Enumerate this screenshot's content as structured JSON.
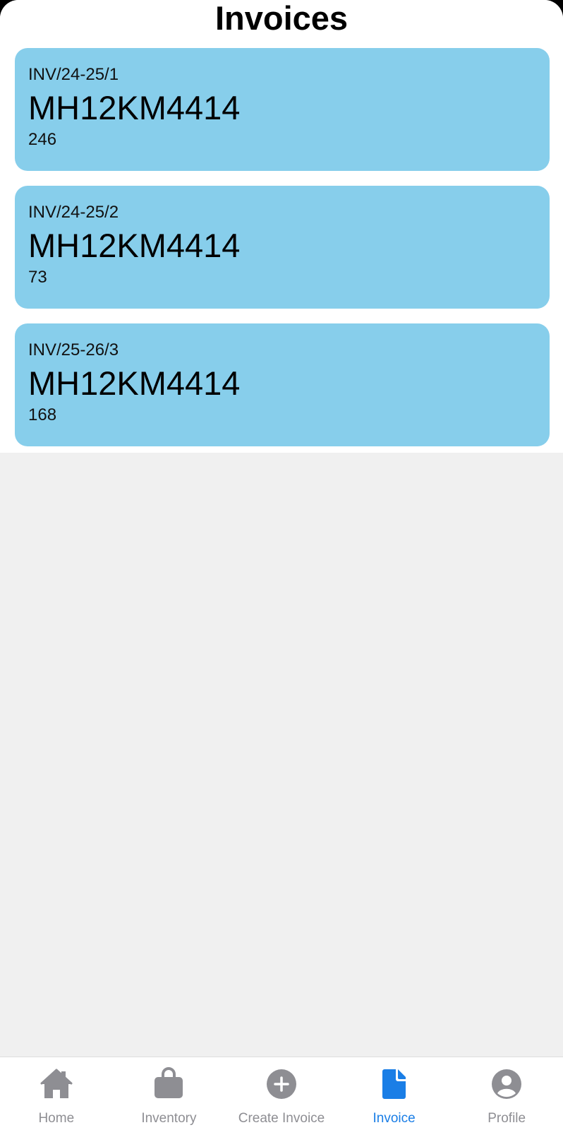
{
  "header": {
    "title": "Invoices"
  },
  "invoices": [
    {
      "number": "INV/24-25/1",
      "vehicle": "MH12KM4414",
      "amount": "246"
    },
    {
      "number": "INV/24-25/2",
      "vehicle": "MH12KM4414",
      "amount": "73"
    },
    {
      "number": "INV/25-26/3",
      "vehicle": "MH12KM4414",
      "amount": "168"
    }
  ],
  "nav": {
    "items": [
      {
        "label": "Home",
        "icon": "home-icon",
        "active": false
      },
      {
        "label": "Inventory",
        "icon": "bag-icon",
        "active": false
      },
      {
        "label": "Create Invoice",
        "icon": "add-circle-icon",
        "active": false
      },
      {
        "label": "Invoice",
        "icon": "document-icon",
        "active": true
      },
      {
        "label": "Profile",
        "icon": "person-circle-icon",
        "active": false
      }
    ],
    "active_color": "#1a7ee6",
    "inactive_color": "#8e8e93"
  },
  "colors": {
    "card_background": "#87ceeb",
    "page_background": "#f0f0f0"
  }
}
